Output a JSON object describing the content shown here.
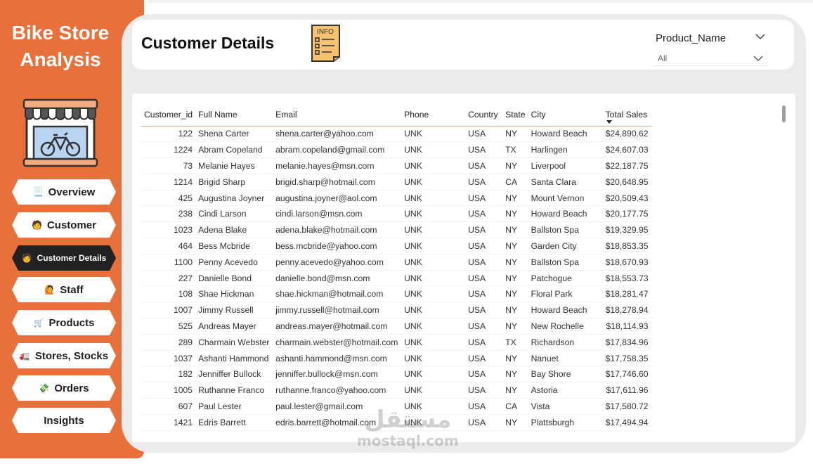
{
  "sidebar": {
    "brand_line1": "Bike Store",
    "brand_line2": "Analysis",
    "nav": [
      {
        "label": "Overview",
        "icon": "📃"
      },
      {
        "label": "Customer",
        "icon": "🧑"
      },
      {
        "label": "Customer Details",
        "icon": "🧑"
      },
      {
        "label": "Staff",
        "icon": "🙋"
      },
      {
        "label": "Products",
        "icon": "🛒"
      },
      {
        "label": "Stores, Stocks",
        "icon": "🚛"
      },
      {
        "label": "Orders",
        "icon": "💸"
      },
      {
        "label": "Insights",
        "icon": ""
      }
    ],
    "active_index": 2
  },
  "header": {
    "title": "Customer Details",
    "info_icon_text": "INFO"
  },
  "slicer": {
    "label": "Product_Name",
    "value": "All"
  },
  "table": {
    "columns": [
      "Customer_id",
      "Full Name",
      "Email",
      "Phone",
      "Country",
      "State",
      "City",
      "Total Sales"
    ],
    "sorted_column": "Total Sales",
    "rows": [
      [
        "122",
        "Shena Carter",
        "shena.carter@yahoo.com",
        "UNK",
        "USA",
        "NY",
        "Howard Beach",
        "$24,890.62"
      ],
      [
        "1224",
        "Abram Copeland",
        "abram.copeland@gmail.com",
        "UNK",
        "USA",
        "TX",
        "Harlingen",
        "$24,607.03"
      ],
      [
        "73",
        "Melanie Hayes",
        "melanie.hayes@msn.com",
        "UNK",
        "USA",
        "NY",
        "Liverpool",
        "$22,187.75"
      ],
      [
        "1214",
        "Brigid Sharp",
        "brigid.sharp@hotmail.com",
        "UNK",
        "USA",
        "CA",
        "Santa Clara",
        "$20,648.95"
      ],
      [
        "425",
        "Augustina Joyner",
        "augustina.joyner@aol.com",
        "UNK",
        "USA",
        "NY",
        "Mount Vernon",
        "$20,509.43"
      ],
      [
        "238",
        "Cindi Larson",
        "cindi.larson@msn.com",
        "UNK",
        "USA",
        "NY",
        "Howard Beach",
        "$20,177.75"
      ],
      [
        "1023",
        "Adena Blake",
        "adena.blake@hotmail.com",
        "UNK",
        "USA",
        "NY",
        "Ballston Spa",
        "$19,329.95"
      ],
      [
        "464",
        "Bess Mcbride",
        "bess.mcbride@yahoo.com",
        "UNK",
        "USA",
        "NY",
        "Garden City",
        "$18,853.35"
      ],
      [
        "1100",
        "Penny Acevedo",
        "penny.acevedo@yahoo.com",
        "UNK",
        "USA",
        "NY",
        "Ballston Spa",
        "$18,670.93"
      ],
      [
        "227",
        "Danielle Bond",
        "danielle.bond@msn.com",
        "UNK",
        "USA",
        "NY",
        "Patchogue",
        "$18,553.73"
      ],
      [
        "108",
        "Shae Hickman",
        "shae.hickman@hotmail.com",
        "UNK",
        "USA",
        "NY",
        "Floral Park",
        "$18,281.47"
      ],
      [
        "1007",
        "Jimmy Russell",
        "jimmy.russell@hotmail.com",
        "UNK",
        "USA",
        "NY",
        "Howard Beach",
        "$18,278.94"
      ],
      [
        "525",
        "Andreas Mayer",
        "andreas.mayer@hotmail.com",
        "UNK",
        "USA",
        "NY",
        "New Rochelle",
        "$18,114.93"
      ],
      [
        "289",
        "Charmain Webster",
        "charmain.webster@hotmail.com",
        "UNK",
        "USA",
        "TX",
        "Richardson",
        "$17,834.96"
      ],
      [
        "1037",
        "Ashanti Hammond",
        "ashanti.hammond@msn.com",
        "UNK",
        "USA",
        "NY",
        "Nanuet",
        "$17,758.35"
      ],
      [
        "182",
        "Jenniffer Bullock",
        "jenniffer.bullock@msn.com",
        "UNK",
        "USA",
        "NY",
        "Bay Shore",
        "$17,746.60"
      ],
      [
        "1005",
        "Ruthanne Franco",
        "ruthanne.franco@yahoo.com",
        "UNK",
        "USA",
        "NY",
        "Astoria",
        "$17,611.96"
      ],
      [
        "607",
        "Paul Lester",
        "paul.lester@gmail.com",
        "UNK",
        "USA",
        "CA",
        "Vista",
        "$17,580.72"
      ],
      [
        "1421",
        "Edris Barrett",
        "edris.barrett@hotmail.com",
        "UNK",
        "USA",
        "NY",
        "Plattsburgh",
        "$17,494.94"
      ]
    ]
  },
  "watermark": {
    "arabic": "مستقل",
    "latin": "mostaql.com"
  },
  "colors": {
    "sidebar": "#E8703A",
    "active_nav": "#222222",
    "header_rule": "#E8A883"
  }
}
